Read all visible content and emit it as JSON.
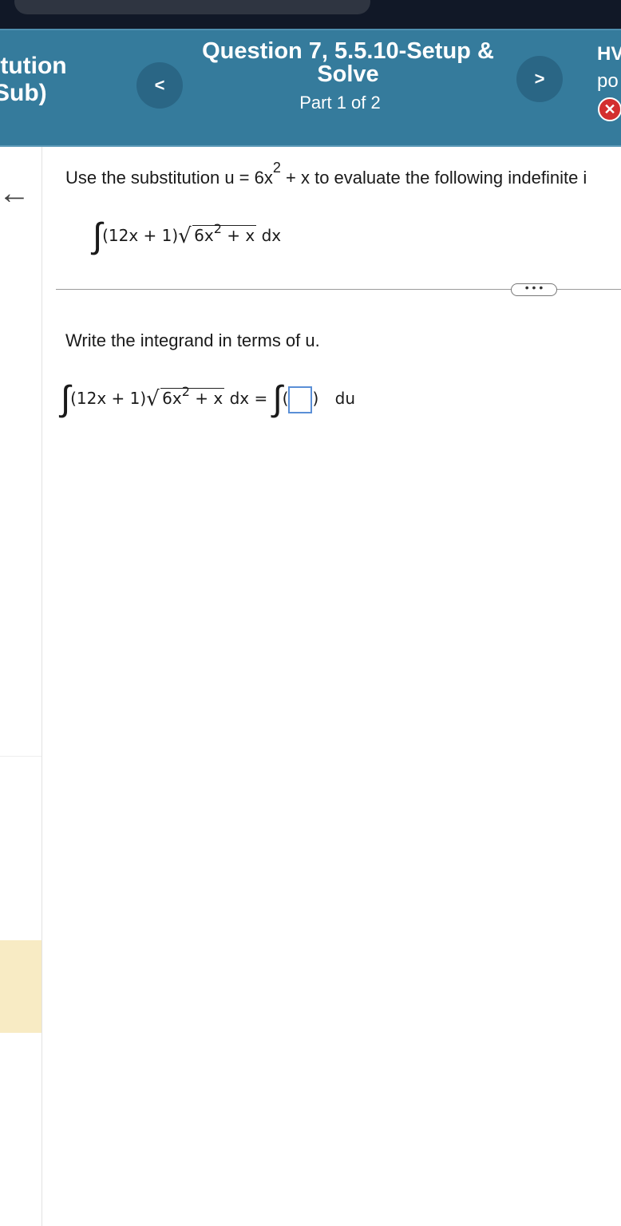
{
  "header": {
    "assignment_title_line1": "itution",
    "assignment_title_line2": "Sub)",
    "question_title": "Question 7, 5.5.10-Setup & Solve",
    "part_label": "Part 1 of 2",
    "hw_label": "HV",
    "points_label": "po",
    "prev_symbol": "<",
    "next_symbol": ">",
    "close_symbol": "✕"
  },
  "problem": {
    "prompt_prefix": "Use the substitution u = 6x",
    "prompt_exponent": "2",
    "prompt_suffix": " + x to evaluate the following indefinite i",
    "integrand_factor": "(12x + 1)",
    "radicand_base": "6x",
    "radicand_exp": "2",
    "radicand_rest": " + x",
    "differential": "dx",
    "more_label": "• • •"
  },
  "step": {
    "instruction": "Write the integrand in terms of u.",
    "lhs_factor": "(12x + 1)",
    "lhs_radicand_base": "6x",
    "lhs_radicand_exp": "2",
    "lhs_radicand_rest": " + x",
    "lhs_differential": "dx =",
    "rhs_open": "(",
    "rhs_close": ")",
    "rhs_differential": "du"
  },
  "colors": {
    "header_bg": "#357b9c",
    "nav_button": "#2a6685",
    "close_red": "#d32f2f",
    "highlight_rail": "#f8ebc4"
  }
}
